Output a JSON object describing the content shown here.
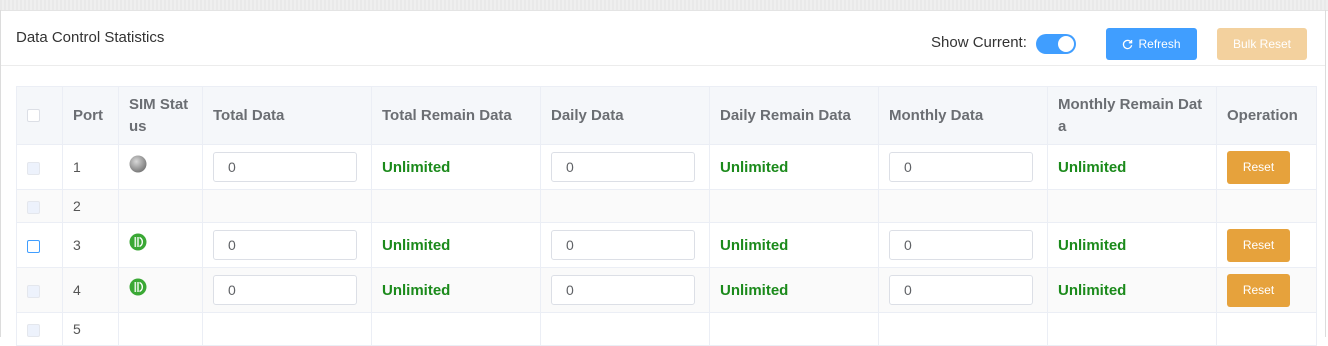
{
  "header": {
    "title": "Data Control Statistics",
    "show_current_label": "Show Current:",
    "show_current_on": true,
    "refresh_label": "Refresh",
    "bulk_reset_label": "Bulk Reset"
  },
  "table": {
    "columns": [
      "Port",
      "SIM Status",
      "Total Data",
      "Total Remain Data",
      "Daily Data",
      "Daily Remain Data",
      "Monthly Data",
      "Monthly Remain Data",
      "Operation"
    ],
    "header_lines": {
      "sim_status": [
        "SIM Stat",
        "us"
      ],
      "monthly_remain": [
        "Monthly Remain Dat",
        "a"
      ]
    },
    "rows": [
      {
        "port": "1",
        "sim": "grey",
        "total": "0",
        "total_remain": "Unlimited",
        "daily": "0",
        "daily_remain": "Unlimited",
        "monthly": "0",
        "monthly_remain": "Unlimited",
        "op": "Reset"
      },
      {
        "port": "2"
      },
      {
        "port": "3",
        "sim": "green",
        "total": "0",
        "total_remain": "Unlimited",
        "daily": "0",
        "daily_remain": "Unlimited",
        "monthly": "0",
        "monthly_remain": "Unlimited",
        "op": "Reset"
      },
      {
        "port": "4",
        "sim": "green",
        "total": "0",
        "total_remain": "Unlimited",
        "daily": "0",
        "daily_remain": "Unlimited",
        "monthly": "0",
        "monthly_remain": "Unlimited",
        "op": "Reset"
      },
      {
        "port": "5"
      }
    ]
  },
  "colors": {
    "primary": "#409eff",
    "warning": "#e6a23c",
    "warning_disabled": "#f3d19e",
    "unlimited_text": "#1b8a1b"
  }
}
